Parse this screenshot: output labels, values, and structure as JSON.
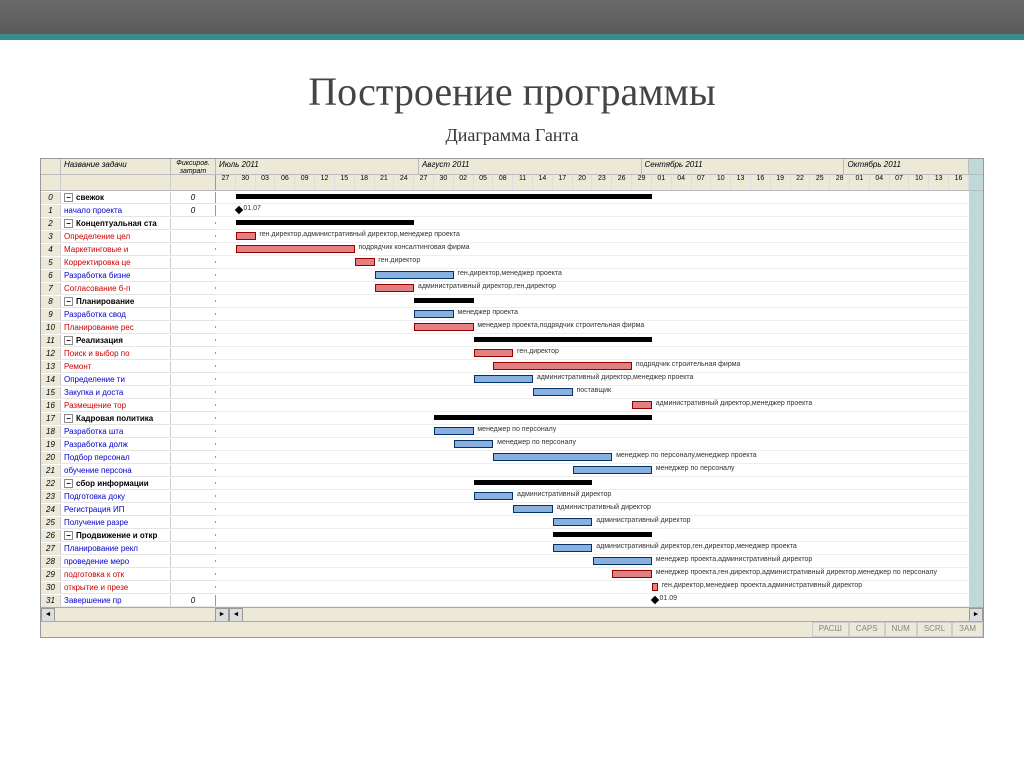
{
  "slide": {
    "title": "Построение программы",
    "subtitle": "Диаграмма Ганта"
  },
  "headers": {
    "name": "Название задачи",
    "cost": "Фиксиров. затрат"
  },
  "months": [
    {
      "label": "Июль 2011",
      "span": 10
    },
    {
      "label": "Август 2011",
      "span": 11
    },
    {
      "label": "Сентябрь 2011",
      "span": 10
    },
    {
      "label": "Октябрь 2011",
      "span": 6
    }
  ],
  "days": [
    "27",
    "30",
    "03",
    "06",
    "09",
    "12",
    "15",
    "18",
    "21",
    "24",
    "27",
    "30",
    "02",
    "05",
    "08",
    "11",
    "14",
    "17",
    "20",
    "23",
    "26",
    "29",
    "01",
    "04",
    "07",
    "10",
    "13",
    "16",
    "19",
    "22",
    "25",
    "28",
    "01",
    "04",
    "07",
    "10",
    "13",
    "16"
  ],
  "status": [
    "РАСШ",
    "CAPS",
    "NUM",
    "SCRL",
    "ЗАМ"
  ],
  "chart_data": {
    "type": "gantt",
    "title": "Диаграмма Ганта",
    "x_start": "2011-06-27",
    "x_end": "2011-10-16",
    "tasks": [
      {
        "id": 0,
        "name": "свежок",
        "kind": "summary",
        "style": "summary",
        "cost": "0",
        "start": 1,
        "end": 22
      },
      {
        "id": 1,
        "name": "начало проекта",
        "kind": "milestone",
        "style": "normal",
        "cost": "0",
        "date": 1,
        "label": "01.07"
      },
      {
        "id": 2,
        "name": "Концептуальная ста",
        "kind": "summary",
        "style": "summary",
        "start": 1,
        "end": 10
      },
      {
        "id": 3,
        "name": "Определение цел",
        "kind": "task",
        "style": "critical",
        "start": 1,
        "end": 2,
        "resource": "ген.директор,административный директор,менеджер проекта"
      },
      {
        "id": 4,
        "name": "Маркетинговые и",
        "kind": "task",
        "style": "critical",
        "start": 1,
        "end": 7,
        "resource": "подрядчик  консалтинговая фирма"
      },
      {
        "id": 5,
        "name": "Корректировка це",
        "kind": "task",
        "style": "critical",
        "start": 7,
        "end": 8,
        "resource": "ген.директор"
      },
      {
        "id": 6,
        "name": "Разработка бизне",
        "kind": "task",
        "style": "normal",
        "start": 8,
        "end": 12,
        "resource": "ген.директор,менеджер проекта"
      },
      {
        "id": 7,
        "name": "Согласование б-п",
        "kind": "task",
        "style": "critical",
        "start": 8,
        "end": 10,
        "resource": "административный директор,ген.директор"
      },
      {
        "id": 8,
        "name": "Планирование",
        "kind": "summary",
        "style": "summary",
        "start": 10,
        "end": 13
      },
      {
        "id": 9,
        "name": "Разработка свод",
        "kind": "task",
        "style": "normal",
        "start": 10,
        "end": 12,
        "resource": "менеджер проекта"
      },
      {
        "id": 10,
        "name": "Планирование рес",
        "kind": "task",
        "style": "critical",
        "start": 10,
        "end": 13,
        "resource": "менеджер проекта,подрядчик  строительная фирма"
      },
      {
        "id": 11,
        "name": "Реализация",
        "kind": "summary",
        "style": "summary",
        "start": 13,
        "end": 22
      },
      {
        "id": 12,
        "name": "Поиск и выбор по",
        "kind": "task",
        "style": "critical",
        "start": 13,
        "end": 15,
        "resource": "ген.директор"
      },
      {
        "id": 13,
        "name": "Ремонт",
        "kind": "task",
        "style": "critical",
        "start": 14,
        "end": 21,
        "resource": "подрядчик  строительная фирма"
      },
      {
        "id": 14,
        "name": "Определение ти",
        "kind": "task",
        "style": "normal",
        "start": 13,
        "end": 16,
        "resource": "административный директор,менеджер проекта"
      },
      {
        "id": 15,
        "name": "Закупка и доста",
        "kind": "task",
        "style": "normal",
        "start": 16,
        "end": 18,
        "resource": "поставщик"
      },
      {
        "id": 16,
        "name": "Размещение тор",
        "kind": "task",
        "style": "critical",
        "start": 21,
        "end": 22,
        "resource": "административный директор,менеджер проекта"
      },
      {
        "id": 17,
        "name": "Кадровая политика",
        "kind": "summary",
        "style": "summary",
        "start": 11,
        "end": 22
      },
      {
        "id": 18,
        "name": "Разработка шта",
        "kind": "task",
        "style": "normal",
        "start": 11,
        "end": 13,
        "resource": "менеджер по персоналу"
      },
      {
        "id": 19,
        "name": "Разработка долж",
        "kind": "task",
        "style": "normal",
        "start": 12,
        "end": 14,
        "resource": "менеджер по персоналу"
      },
      {
        "id": 20,
        "name": "Подбор персонал",
        "kind": "task",
        "style": "normal",
        "start": 14,
        "end": 20,
        "resource": "менеджер по персоналу,менеджер проекта"
      },
      {
        "id": 21,
        "name": "обучение персона",
        "kind": "task",
        "style": "normal",
        "start": 18,
        "end": 22,
        "resource": "менеджер по персоналу"
      },
      {
        "id": 22,
        "name": "сбор информации",
        "kind": "summary",
        "style": "summary",
        "start": 13,
        "end": 19
      },
      {
        "id": 23,
        "name": "Подготовка доку",
        "kind": "task",
        "style": "normal",
        "start": 13,
        "end": 15,
        "resource": "административный директор"
      },
      {
        "id": 24,
        "name": "Регистрация ИП",
        "kind": "task",
        "style": "normal",
        "start": 15,
        "end": 17,
        "resource": "административный директор"
      },
      {
        "id": 25,
        "name": "Получение разре",
        "kind": "task",
        "style": "normal",
        "start": 17,
        "end": 19,
        "resource": "административный директор"
      },
      {
        "id": 26,
        "name": "Продвижение и откр",
        "kind": "summary",
        "style": "summary",
        "start": 17,
        "end": 22
      },
      {
        "id": 27,
        "name": "Планирование рекл",
        "kind": "task",
        "style": "normal",
        "start": 17,
        "end": 19,
        "resource": "административный директор,ген.директор,менеджер проекта"
      },
      {
        "id": 28,
        "name": "проведение меро",
        "kind": "task",
        "style": "normal",
        "start": 19,
        "end": 22,
        "resource": "менеджер проекта,административный директор"
      },
      {
        "id": 29,
        "name": "подготовка к отк",
        "kind": "task",
        "style": "critical",
        "start": 20,
        "end": 22,
        "resource": "менеджер проекта,ген.директор,административный директор,менеджер по персоналу"
      },
      {
        "id": 30,
        "name": "открытие и презе",
        "kind": "task",
        "style": "critical",
        "start": 22,
        "end": 22.3,
        "resource": "ген.директор,менеджер проекта,административный директор"
      },
      {
        "id": 31,
        "name": "Завершение пр",
        "kind": "milestone",
        "style": "normal",
        "cost": "0",
        "date": 22,
        "label": "01.09"
      }
    ]
  }
}
